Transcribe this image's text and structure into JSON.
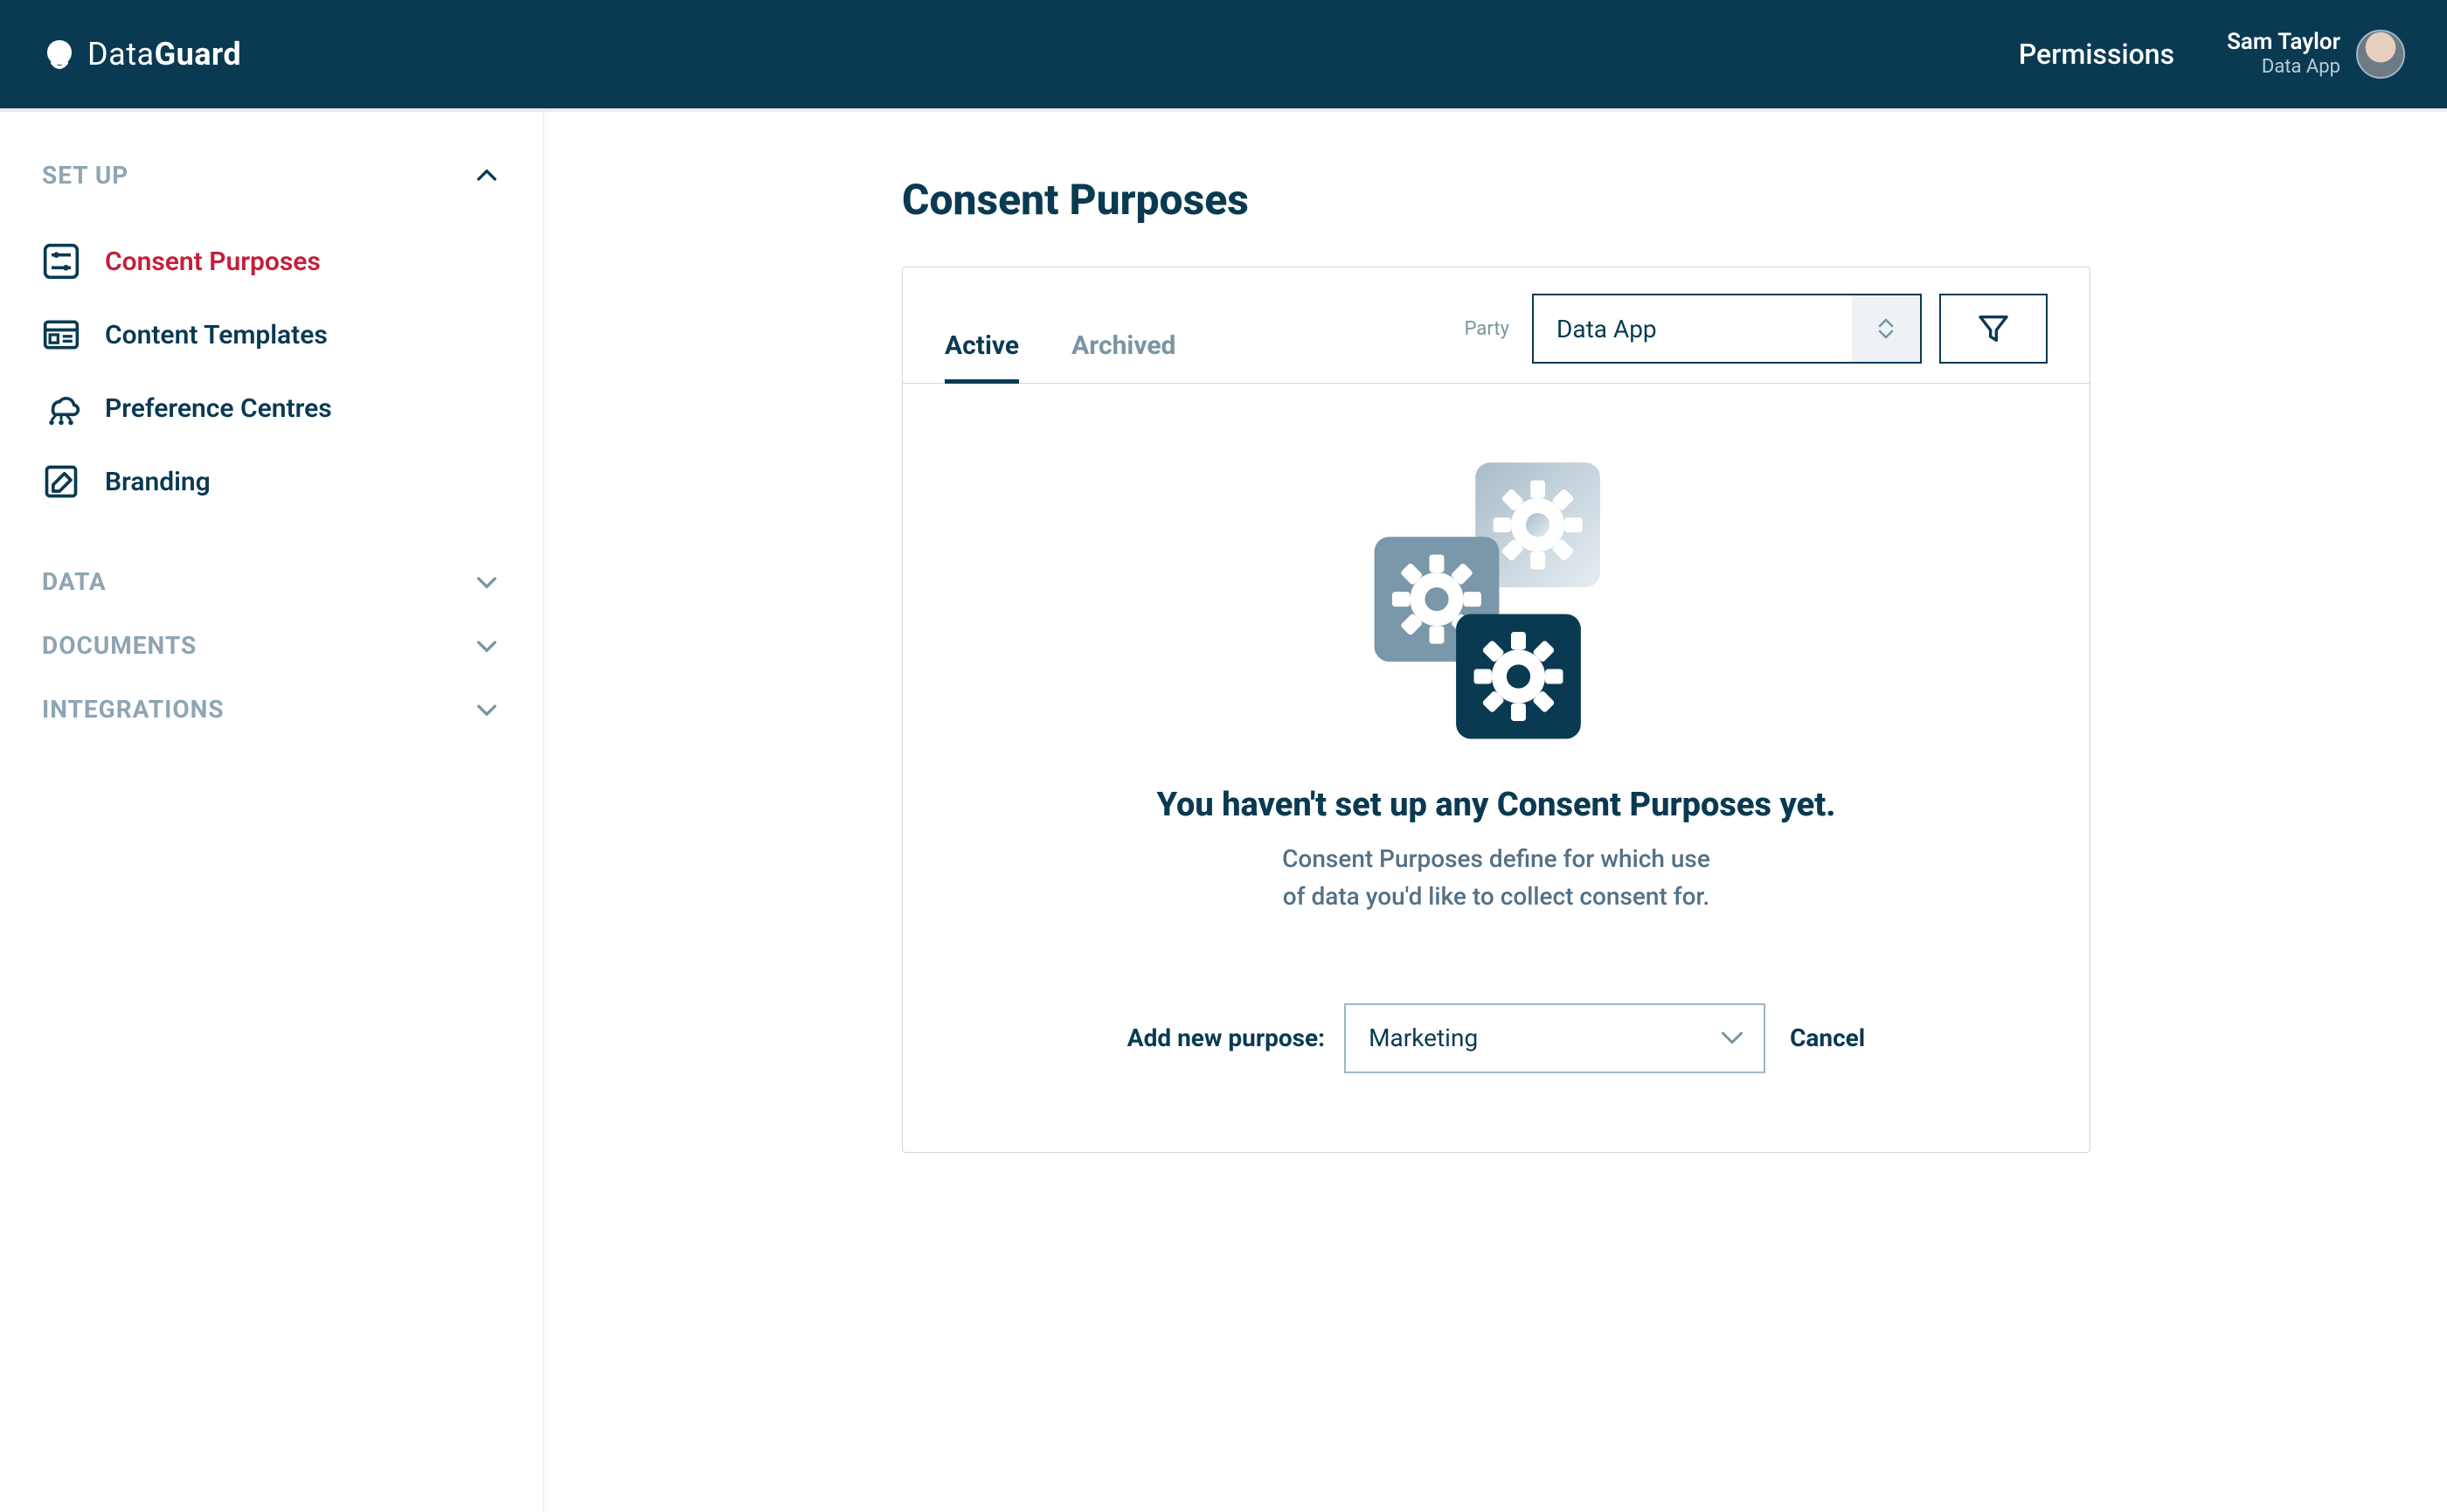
{
  "header": {
    "logo_prefix": "Data",
    "logo_suffix": "Guard",
    "nav_permissions": "Permissions",
    "user_name": "Sam Taylor",
    "user_sub": "Data App"
  },
  "sidebar": {
    "sections": [
      {
        "label": "SET UP",
        "expanded": true
      },
      {
        "label": "DATA",
        "expanded": false
      },
      {
        "label": "DOCUMENTS",
        "expanded": false
      },
      {
        "label": "INTEGRATIONS",
        "expanded": false
      }
    ],
    "setup_items": [
      {
        "label": "Consent Purposes",
        "active": true
      },
      {
        "label": "Content Templates",
        "active": false
      },
      {
        "label": "Preference Centres",
        "active": false
      },
      {
        "label": "Branding",
        "active": false
      }
    ]
  },
  "page": {
    "title": "Consent Purposes",
    "tabs": {
      "active": "Active",
      "archived": "Archived"
    },
    "party_label": "Party",
    "party_value": "Data App",
    "empty_title": "You haven't set up any Consent Purposes yet.",
    "empty_desc_l1": "Consent Purposes define for which use",
    "empty_desc_l2": "of data you'd like to collect consent for.",
    "add_label": "Add new purpose:",
    "add_value": "Marketing",
    "cancel": "Cancel"
  }
}
